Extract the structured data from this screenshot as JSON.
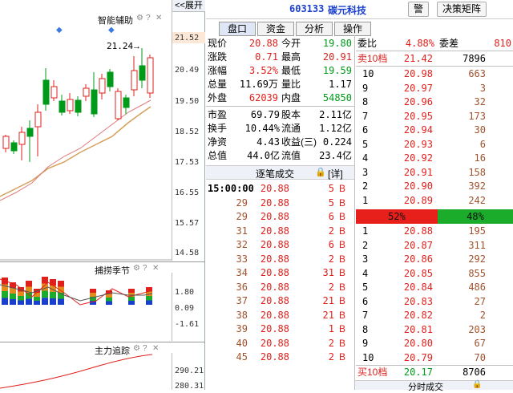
{
  "left": {
    "smart_title": "智能辅助",
    "expand_label": "<<展开",
    "price_marker": "21.24",
    "price_axis": [
      "21.52",
      "20.49",
      "19.50",
      "18.52",
      "17.53",
      "16.55",
      "15.57",
      "14.58"
    ],
    "season_title": "捕捞季节",
    "season_axis": [
      "1.80",
      "0.09",
      "-1.61"
    ],
    "track_title": "主力追踪",
    "track_axis": [
      "290.21",
      "280.31"
    ]
  },
  "header": {
    "code": "603133",
    "name": "碳元科技",
    "alert_btn": "警",
    "matrix_btn": "决策矩阵"
  },
  "tabs": [
    "盘口",
    "资金",
    "分析",
    "操作"
  ],
  "quote": [
    {
      "l1": "现价",
      "v1": "20.88",
      "c1": "red",
      "l2": "今开",
      "v2": "19.80",
      "c2": "grn"
    },
    {
      "l1": "涨跌",
      "v1": "0.71",
      "c1": "red",
      "l2": "最高",
      "v2": "20.91",
      "c2": "red"
    },
    {
      "l1": "涨幅",
      "v1": "3.52%",
      "c1": "red",
      "l2": "最低",
      "v2": "19.59",
      "c2": "grn"
    },
    {
      "l1": "总量",
      "v1": "11.69万",
      "c1": "blk",
      "l2": "量比",
      "v2": "1.17",
      "c2": "blk"
    },
    {
      "l1": "外盘",
      "v1": "62039",
      "c1": "red",
      "l2": "内盘",
      "v2": "54850",
      "c2": "grn"
    }
  ],
  "fund": [
    {
      "l1": "市盈",
      "v1": "69.79",
      "l2": "股本",
      "v2": "2.11亿"
    },
    {
      "l1": "换手",
      "v1": "10.44%",
      "l2": "流通",
      "v2": "1.12亿"
    },
    {
      "l1": "净资",
      "v1": "4.43",
      "l2": "收益(三)",
      "v2": "0.224"
    },
    {
      "l1": "总值",
      "v1": "44.0亿",
      "l2": "流值",
      "v2": "23.4亿"
    }
  ],
  "ticks_title": "逐笔成交",
  "ticks_btn": "[详]",
  "ticks": [
    {
      "t": "15:00:00",
      "p": "20.88",
      "v": "5",
      "s": "B"
    },
    {
      "t": "29",
      "p": "20.88",
      "v": "5",
      "s": "B"
    },
    {
      "t": "29",
      "p": "20.88",
      "v": "6",
      "s": "B"
    },
    {
      "t": "31",
      "p": "20.88",
      "v": "2",
      "s": "B"
    },
    {
      "t": "32",
      "p": "20.88",
      "v": "6",
      "s": "B"
    },
    {
      "t": "33",
      "p": "20.88",
      "v": "2",
      "s": "B"
    },
    {
      "t": "34",
      "p": "20.88",
      "v": "31",
      "s": "B"
    },
    {
      "t": "36",
      "p": "20.88",
      "v": "2",
      "s": "B"
    },
    {
      "t": "37",
      "p": "20.88",
      "v": "21",
      "s": "B"
    },
    {
      "t": "38",
      "p": "20.88",
      "v": "21",
      "s": "B"
    },
    {
      "t": "39",
      "p": "20.88",
      "v": "1",
      "s": "B"
    },
    {
      "t": "40",
      "p": "20.88",
      "v": "2",
      "s": "B"
    },
    {
      "t": "45",
      "p": "20.88",
      "v": "2",
      "s": "B"
    }
  ],
  "order": {
    "wb_label": "委比",
    "wb_val": "4.88%",
    "wc_label": "委差",
    "wc_val": "810",
    "sell10_label": "卖10档",
    "sell10_price": "21.42",
    "sell10_vol": "7896",
    "sells": [
      {
        "n": "10",
        "p": "20.98",
        "v": "663"
      },
      {
        "n": "9",
        "p": "20.97",
        "v": "3"
      },
      {
        "n": "8",
        "p": "20.96",
        "v": "32"
      },
      {
        "n": "7",
        "p": "20.95",
        "v": "173"
      },
      {
        "n": "6",
        "p": "20.94",
        "v": "30"
      },
      {
        "n": "5",
        "p": "20.93",
        "v": "6"
      },
      {
        "n": "4",
        "p": "20.92",
        "v": "16"
      },
      {
        "n": "3",
        "p": "20.91",
        "v": "158"
      },
      {
        "n": "2",
        "p": "20.90",
        "v": "392"
      },
      {
        "n": "1",
        "p": "20.89",
        "v": "242"
      }
    ],
    "sell_pct": "52%",
    "buy_pct": "48%",
    "sell_share": 0.52,
    "buys": [
      {
        "n": "1",
        "p": "20.88",
        "v": "195"
      },
      {
        "n": "2",
        "p": "20.87",
        "v": "311"
      },
      {
        "n": "3",
        "p": "20.86",
        "v": "292"
      },
      {
        "n": "4",
        "p": "20.85",
        "v": "855"
      },
      {
        "n": "5",
        "p": "20.84",
        "v": "486"
      },
      {
        "n": "6",
        "p": "20.83",
        "v": "27"
      },
      {
        "n": "7",
        "p": "20.82",
        "v": "2"
      },
      {
        "n": "8",
        "p": "20.81",
        "v": "203"
      },
      {
        "n": "9",
        "p": "20.80",
        "v": "67"
      },
      {
        "n": "10",
        "p": "20.79",
        "v": "70"
      }
    ],
    "buy10_label": "买10档",
    "buy10_price": "20.17",
    "buy10_vol": "8706"
  },
  "bottom_label": "分时成交",
  "colors": {
    "up": "#e0201c",
    "down": "#009a1a",
    "accent": "#1a3fcc"
  }
}
